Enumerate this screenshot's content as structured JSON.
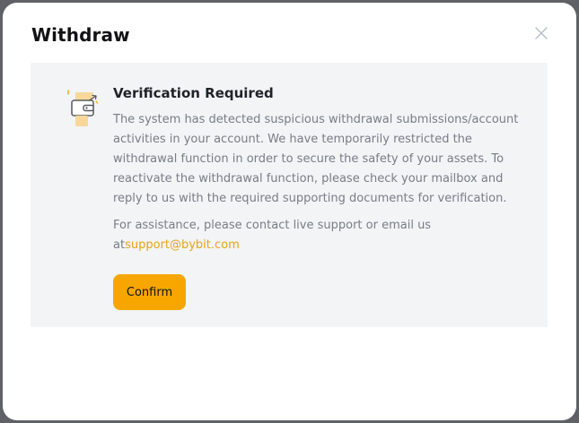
{
  "modal": {
    "title": "Withdraw",
    "close_icon": "close-icon"
  },
  "panel": {
    "heading": "Verification Required",
    "body": "The system has detected suspicious withdrawal submissions/account activities in your account. We have temporarily restricted the withdrawal function in order to secure the safety of your assets. To reactivate the withdrawal function, please check your mailbox and reply to us with the required supporting documents for verification.",
    "assist_prefix": "For assistance, please contact live support or email us at",
    "assist_email": "support@bybit.com",
    "illustration_icon": "wallet-verification-icon"
  },
  "actions": {
    "confirm_label": "Confirm"
  },
  "colors": {
    "accent": "#f7a600",
    "link": "#e8a417",
    "panel_bg": "#f2f4f6",
    "backdrop": "#5f6166"
  }
}
